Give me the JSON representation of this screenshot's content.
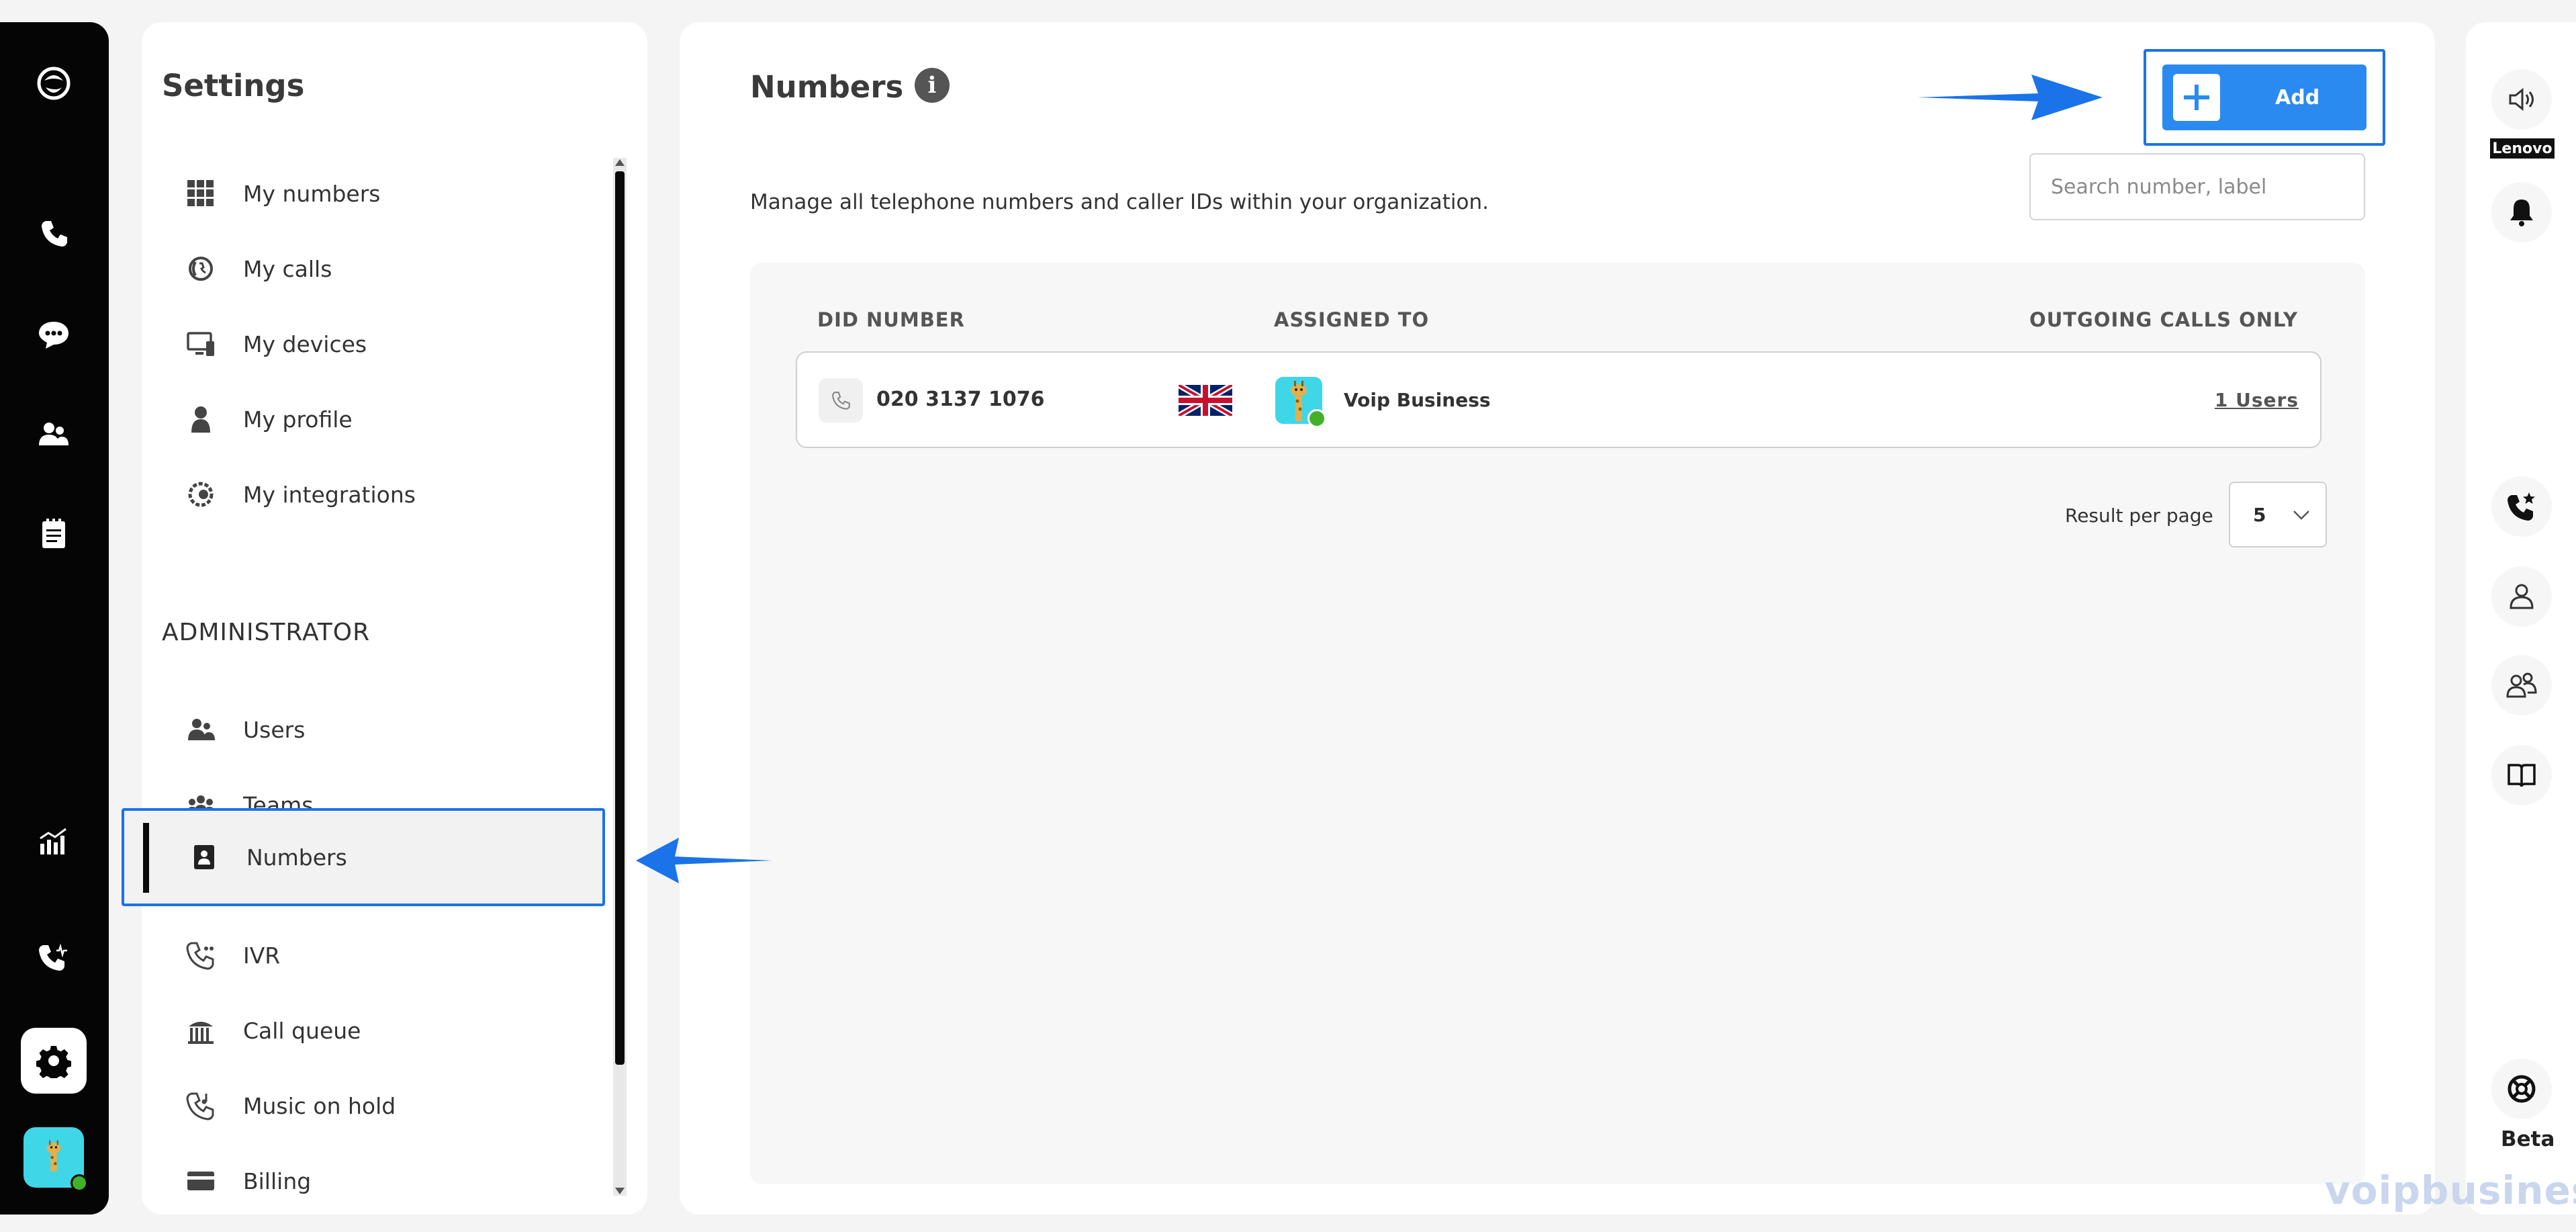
{
  "settings": {
    "title": "Settings",
    "personal_items": [
      {
        "label": "My numbers",
        "icon": "grid-icon"
      },
      {
        "label": "My calls",
        "icon": "calls-icon"
      },
      {
        "label": "My devices",
        "icon": "devices-icon"
      },
      {
        "label": "My profile",
        "icon": "profile-icon"
      },
      {
        "label": "My integrations",
        "icon": "integrations-icon"
      }
    ],
    "admin_heading": "ADMINISTRATOR",
    "admin_items": [
      {
        "label": "Users",
        "icon": "users-icon"
      },
      {
        "label": "Teams",
        "icon": "teams-icon"
      },
      {
        "label": "Numbers",
        "icon": "numbers-icon",
        "selected": true
      },
      {
        "label": "IVR",
        "icon": "ivr-icon"
      },
      {
        "label": "Call queue",
        "icon": "call-queue-icon"
      },
      {
        "label": "Music on hold",
        "icon": "music-on-hold-icon"
      },
      {
        "label": "Billing",
        "icon": "billing-icon"
      }
    ]
  },
  "main": {
    "title": "Numbers",
    "subtitle": "Manage all telephone numbers and caller IDs within your organization.",
    "add_label": "Add",
    "search": {
      "placeholder": "Search number, label",
      "value": ""
    },
    "table": {
      "headers": {
        "did": "DID NUMBER",
        "assigned": "ASSIGNED TO",
        "outgoing": "OUTGOING CALLS ONLY"
      },
      "rows": [
        {
          "did": "020 3137 1076",
          "country_flag": "uk-flag-icon",
          "assigned_to": "Voip Business",
          "outgoing": "1 Users"
        }
      ]
    },
    "pagination": {
      "label": "Result per page",
      "value": "5"
    }
  },
  "right_rail": {
    "device_tag": "Lenovo",
    "beta_label": "Beta"
  },
  "watermark": "voipbusiness",
  "colors": {
    "accent": "#2a8af0",
    "annotation": "#1a73e8",
    "rail": "#050505",
    "avatar_bg": "#3fd7e7",
    "status_ok": "#43b02a"
  }
}
